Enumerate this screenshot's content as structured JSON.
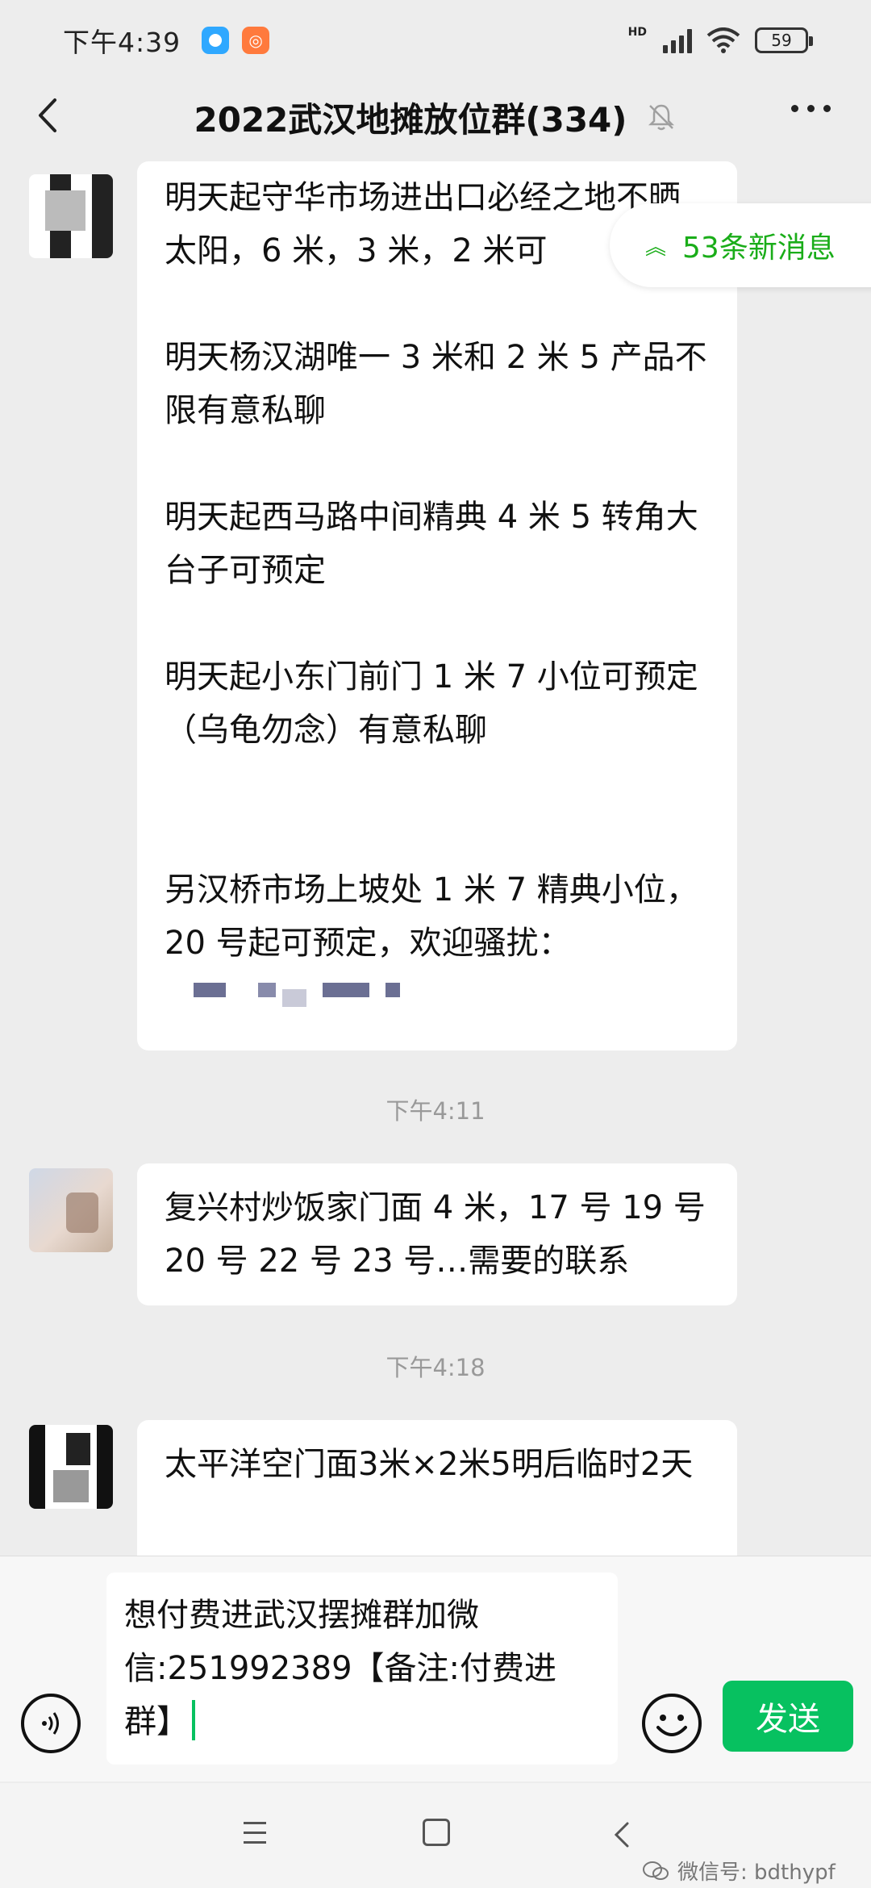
{
  "status_bar": {
    "time": "下午4:39",
    "network": "HD",
    "battery": "59",
    "icons": [
      "app-badge-blue",
      "app-badge-orange",
      "signal-icon",
      "wifi-icon",
      "battery-icon"
    ]
  },
  "header": {
    "title": "2022武汉地摊放位群(334)",
    "icons": [
      "back-arrow-icon",
      "mute-bell-icon",
      "more-icon"
    ]
  },
  "new_messages": {
    "label": "53条新消息",
    "icon": "double-chevron-up-icon"
  },
  "messages": [
    {
      "paragraphs": [
        "明天起守华市场进出口必经之地不晒太阳，6 米，3 米，2 米可",
        "明天杨汉湖唯一 3 米和 2 米 5 产品不限有意私聊",
        "明天起西马路中间精典 4 米 5 转角大台子可预定",
        "明天起小东门前门 1 米 7 小位可预定（乌龟勿念）有意私聊",
        "另汉桥市场上坡处 1 米 7 精典小位，20 号起可预定，欢迎骚扰："
      ]
    },
    {
      "time": "下午4:11",
      "paragraphs": [
        "复兴村炒饭家门面 4 米，17 号 19 号 20 号 22 号 23 号…需要的联系"
      ]
    },
    {
      "time": "下午4:18",
      "paragraphs": [
        "太平洋空门面3米×2米5明后临时2天"
      ]
    }
  ],
  "input": {
    "value": "想付费进武汉摆摊群加微信:251992389【备注:付费进群】",
    "send_label": "发送"
  },
  "watermark": {
    "text": "微信号: bdthypf"
  },
  "colors": {
    "accent": "#07c160",
    "background": "#ededed",
    "bubble": "#ffffff"
  }
}
